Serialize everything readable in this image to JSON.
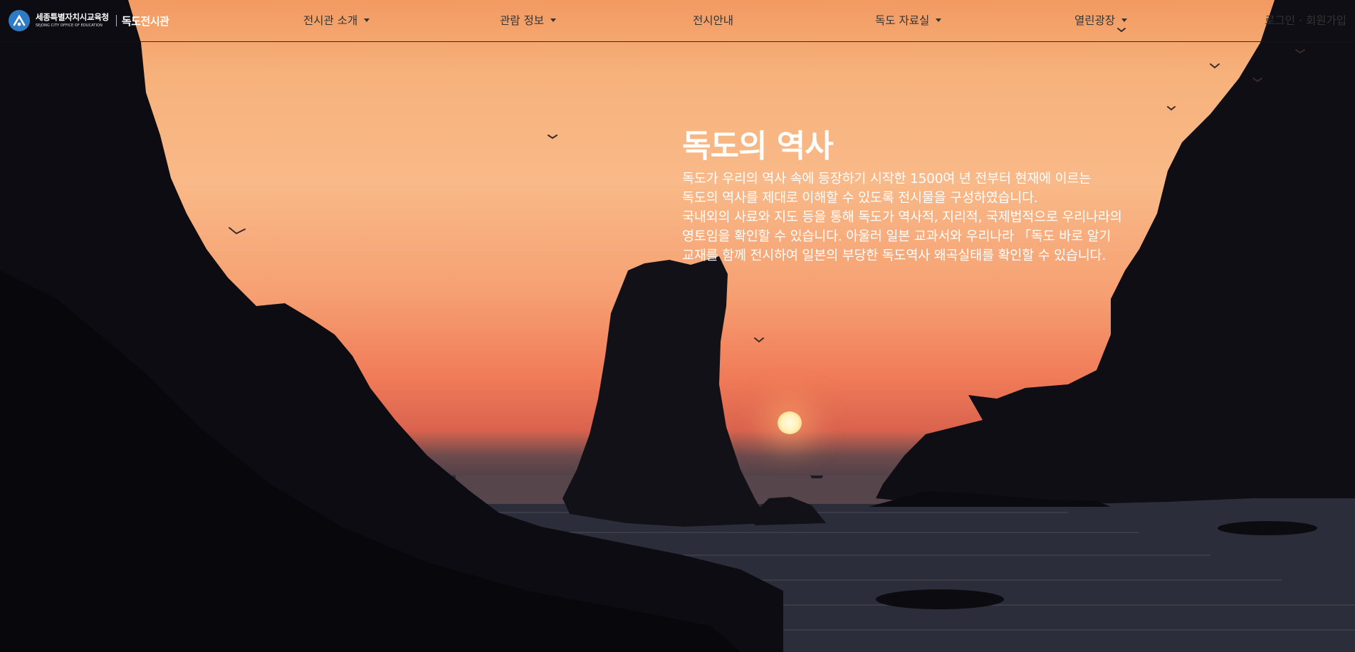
{
  "header": {
    "org_name_ko": "세종특별자치시교육청",
    "org_name_en": "SEJONG CITY OFFICE OF EDUCATION",
    "site_name": "독도전시관",
    "nav": [
      {
        "label": "전시관 소개",
        "dropdown": true
      },
      {
        "label": "관람 정보",
        "dropdown": true
      },
      {
        "label": "전시안내",
        "dropdown": false
      },
      {
        "label": "독도 자료실",
        "dropdown": true
      },
      {
        "label": "열린광장",
        "dropdown": true
      }
    ],
    "login_label": "로그인",
    "separator": "·",
    "signup_label": "회원가입"
  },
  "hero": {
    "title": "독도의 역사",
    "paragraph_lines": [
      "독도가 우리의 역사 속에 등장하기 시작한 1500여 년 전부터 현재에 이르는",
      "독도의 역사를 제대로 이해할 수 있도록 전시물을 구성하였습니다.",
      "국내외의 사료와 지도 등을 통해 독도가 역사적, 지리적, 국제법적으로 우리나라의",
      "영토임을 확인할 수 있습니다. 아울러 일본 교과서와 우리나라 「독도 바로 알기",
      "교재를 함께 전시하여 일본의 부당한 독도역사 왜곡실태를 확인할 수 있습니다."
    ]
  },
  "icons": {
    "logo": "sejong-education-logo-icon",
    "nav_caret": "caret-down-icon"
  },
  "colors": {
    "nav_text": "#333333",
    "hero_text": "#ffffff",
    "logo_blue": "#2e7bc4",
    "sky_orange": "#f7b27c"
  }
}
